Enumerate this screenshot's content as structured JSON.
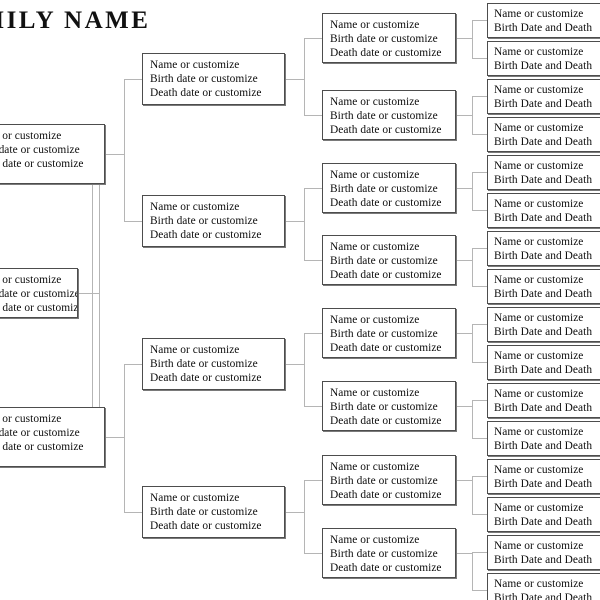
{
  "chart": {
    "title": "FAMILY NAME",
    "title_visible_fragment": "LY NAME",
    "type": "family-tree-pedigree",
    "generations": 5,
    "colors": {
      "box_border": "#4d4d4d",
      "box_shadow": "#7a7a7a",
      "connector": "#b5b5b5",
      "text": "#0d0d0d",
      "background": "#ffffff"
    },
    "labels": {
      "name_line": "Name or customize",
      "birth_line": "Birth date or customize",
      "death_line": "Death date or customize",
      "birth_death_line": "Birth Date and Death"
    }
  },
  "root": {
    "line1": "Name or customize",
    "line2": "Birth date or customize",
    "line3": "Death date or customize"
  },
  "generation1": [
    {
      "line1": "Name or customize",
      "line2": "Birth date or customize",
      "line3": "Death date or customize"
    },
    {
      "line1": "Name or customize",
      "line2": "Birth date or customize",
      "line3": "Death date or customize"
    }
  ],
  "generation2": [
    {
      "line1": "Name or customize",
      "line2": "Birth date or customize",
      "line3": "Death date or customize"
    },
    {
      "line1": "Name or customize",
      "line2": "Birth date or customize",
      "line3": "Death date or customize"
    },
    {
      "line1": "Name or customize",
      "line2": "Birth date or customize",
      "line3": "Death date or customize"
    },
    {
      "line1": "Name or customize",
      "line2": "Birth date or customize",
      "line3": "Death date or customize"
    }
  ],
  "generation3": [
    {
      "line1": "Name or customize",
      "line2": "Birth date or customize",
      "line3": "Death date or customize"
    },
    {
      "line1": "Name or customize",
      "line2": "Birth date or customize",
      "line3": "Death date or customize"
    },
    {
      "line1": "Name or customize",
      "line2": "Birth date or customize",
      "line3": "Death date or customize"
    },
    {
      "line1": "Name or customize",
      "line2": "Birth date or customize",
      "line3": "Death date or customize"
    },
    {
      "line1": "Name or customize",
      "line2": "Birth date or customize",
      "line3": "Death date or customize"
    },
    {
      "line1": "Name or customize",
      "line2": "Birth date or customize",
      "line3": "Death date or customize"
    },
    {
      "line1": "Name or customize",
      "line2": "Birth date or customize",
      "line3": "Death date or customize"
    },
    {
      "line1": "Name or customize",
      "line2": "Birth date or customize",
      "line3": "Death date or customize"
    }
  ],
  "generation4": [
    {
      "line1": "Name or customize",
      "line2": "Birth Date and Death"
    },
    {
      "line1": "Name or customize",
      "line2": "Birth Date and Death"
    },
    {
      "line1": "Name or customize",
      "line2": "Birth Date and Death"
    },
    {
      "line1": "Name or customize",
      "line2": "Birth Date and Death"
    },
    {
      "line1": "Name or customize",
      "line2": "Birth Date and Death"
    },
    {
      "line1": "Name or customize",
      "line2": "Birth Date and Death"
    },
    {
      "line1": "Name or customize",
      "line2": "Birth Date and Death"
    },
    {
      "line1": "Name or customize",
      "line2": "Birth Date and Death"
    },
    {
      "line1": "Name or customize",
      "line2": "Birth Date and Death"
    },
    {
      "line1": "Name or customize",
      "line2": "Birth Date and Death"
    },
    {
      "line1": "Name or customize",
      "line2": "Birth Date and Death"
    },
    {
      "line1": "Name or customize",
      "line2": "Birth Date and Death"
    },
    {
      "line1": "Name or customize",
      "line2": "Birth Date and Death"
    },
    {
      "line1": "Name or customize",
      "line2": "Birth Date and Death"
    },
    {
      "line1": "Name or customize",
      "line2": "Birth Date and Death"
    },
    {
      "line1": "Name or customize",
      "line2": "Birth Date and Death"
    }
  ]
}
